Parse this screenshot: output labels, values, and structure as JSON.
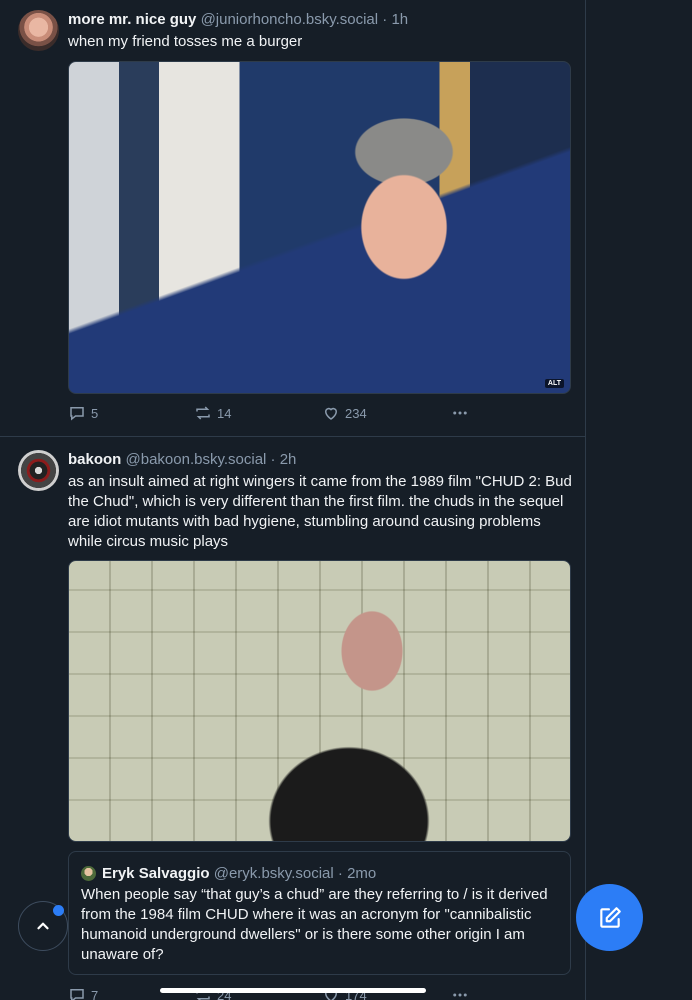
{
  "posts": [
    {
      "author": {
        "name": "more mr. nice guy",
        "handle": "@juniorhoncho.bsky.social",
        "time": "1h"
      },
      "text": "when my friend tosses me a burger",
      "media": {
        "alt_badge": "ALT"
      },
      "actions": {
        "replies": "5",
        "reposts": "14",
        "likes": "234"
      }
    },
    {
      "author": {
        "name": "bakoon",
        "handle": "@bakoon.bsky.social",
        "time": "2h"
      },
      "text": "as an insult aimed at right wingers it came from the 1989 film \"CHUD 2: Bud the Chud\", which is very different than the first film. the chuds in the sequel are idiot mutants with bad hygiene, stumbling around causing problems while circus music plays",
      "quote": {
        "name": "Eryk Salvaggio",
        "handle": "@eryk.bsky.social",
        "time": "2mo",
        "text": "When people say “that guy’s a chud” are they referring to / is it derived from the 1984 film CHUD where it was an acronym for \"cannibalistic humanoid underground dwellers\" or is there some other origin I am unaware of?"
      },
      "actions": {
        "replies": "7",
        "reposts": "24",
        "likes": "174"
      }
    }
  ],
  "separator": "·",
  "colors": {
    "background": "#161e27",
    "accent": "#2c7df6",
    "muted": "#8a9aac",
    "border": "#2e3b49"
  },
  "icons": [
    "reply-icon",
    "repost-icon",
    "like-icon",
    "more-icon",
    "chevron-up-icon",
    "compose-icon"
  ]
}
